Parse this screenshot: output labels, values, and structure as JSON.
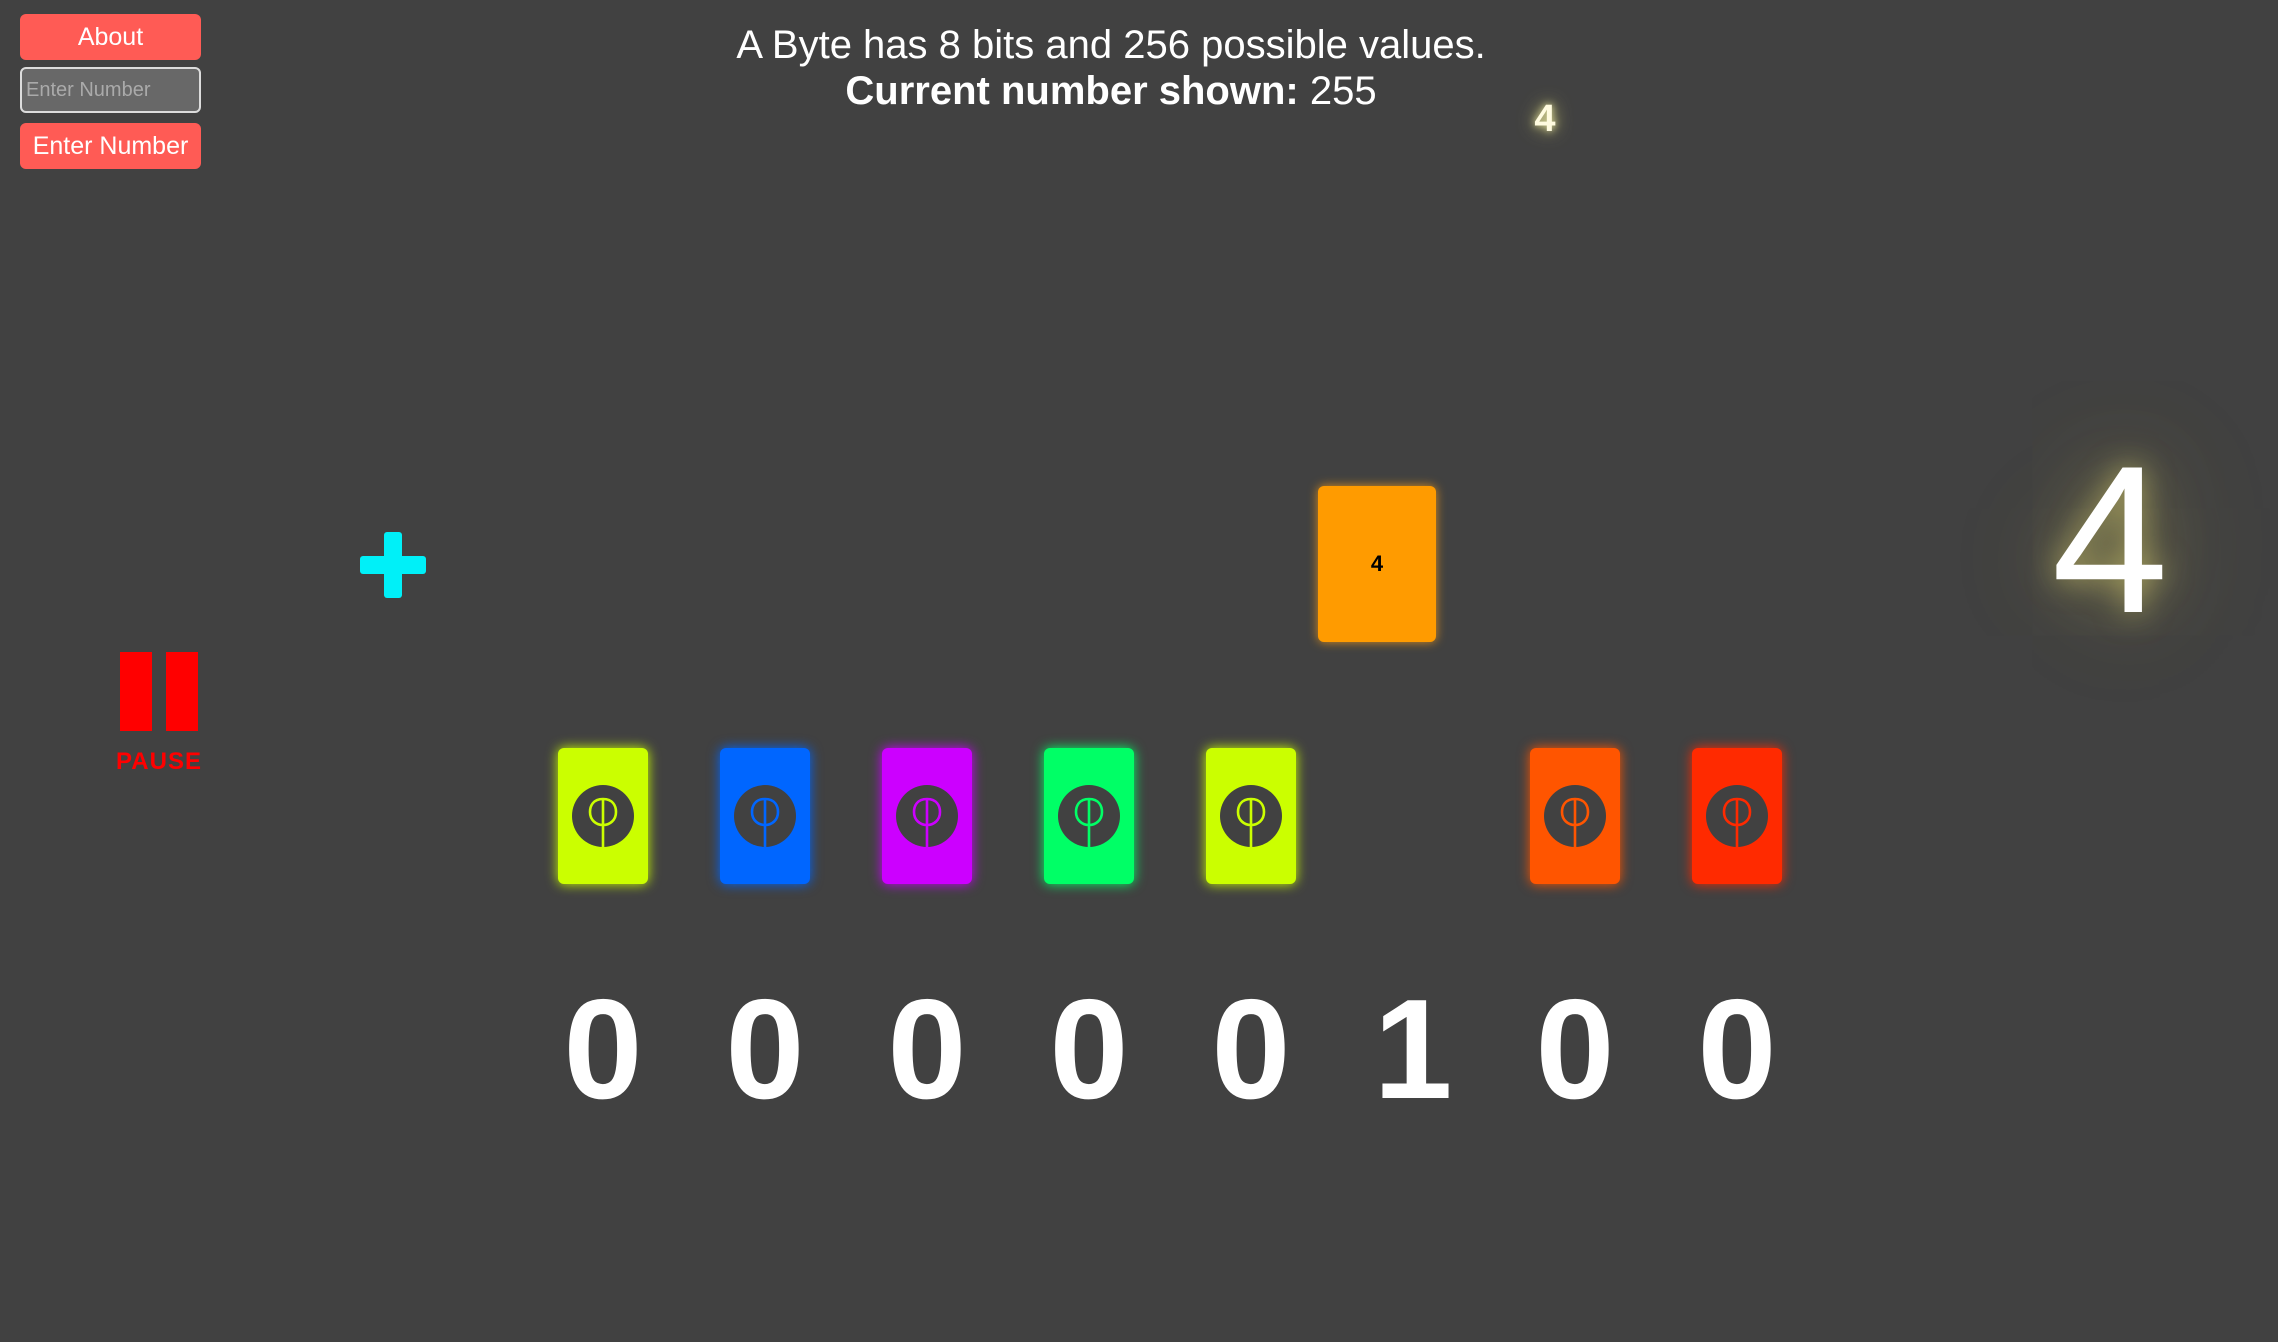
{
  "controls": {
    "about_label": "About",
    "input_placeholder": "Enter Number",
    "enter_label": "Enter Number",
    "pause_label": "PAUSE"
  },
  "header": {
    "line1": "A Byte has 8 bits and 256 possible values.",
    "current_label": "Current number shown:",
    "current_value": "255"
  },
  "animation": {
    "small_value": "4",
    "falling_card_value": "4",
    "big_value": "4",
    "falling_card_color": "#ff9b00"
  },
  "icons": {
    "plus": "plus-icon",
    "pause": "pause-icon",
    "card_symbol": "phi-circle-icon"
  },
  "bits": [
    {
      "digit": "0",
      "color": "#cbff00",
      "card_visible": true
    },
    {
      "digit": "0",
      "color": "#0066ff",
      "card_visible": true
    },
    {
      "digit": "0",
      "color": "#cc00ff",
      "card_visible": true
    },
    {
      "digit": "0",
      "color": "#00ff66",
      "card_visible": true
    },
    {
      "digit": "0",
      "color": "#cbff00",
      "card_visible": true
    },
    {
      "digit": "1",
      "color": "#ff9b00",
      "card_visible": false
    },
    {
      "digit": "0",
      "color": "#ff5500",
      "card_visible": true
    },
    {
      "digit": "0",
      "color": "#ff2a00",
      "card_visible": true
    }
  ],
  "colors": {
    "background": "#414141",
    "button": "#ff5b55",
    "plus": "#00f0f8",
    "pause": "#ff0000"
  }
}
